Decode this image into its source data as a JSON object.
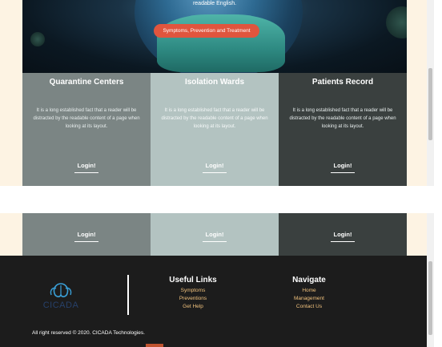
{
  "hero": {
    "text": "readable English.",
    "button_label": "Symptoms, Prevention and Treatment"
  },
  "cards": [
    {
      "title": "Quarantine Centers",
      "text": "It is a long established fact that a reader will be distracted by the readable content of a page when looking at its layout.",
      "login": "Login!"
    },
    {
      "title": "Isolation Wards",
      "text": "It is a long established fact that a reader will be distracted by the readable content of a page when looking at its layout.",
      "login": "Login!"
    },
    {
      "title": "Patients Record",
      "text": "It is a long established fact that a reader will be distracted by the readable content of a page when looking at its layout.",
      "login": "Login!"
    }
  ],
  "bottom_cards": [
    {
      "login": "Login!"
    },
    {
      "login": "Login!"
    },
    {
      "login": "Login!"
    }
  ],
  "footer": {
    "logo_text": "CICADA",
    "useful_links": {
      "title": "Useful Links",
      "items": [
        "Symptoms",
        "Preventions",
        "Get Help"
      ]
    },
    "navigate": {
      "title": "Navigate",
      "items": [
        "Home",
        "Management",
        "Contact Us"
      ]
    },
    "copyright": "All right reserved © 2020. CICADA Technologies."
  },
  "colors": {
    "accent_button": "#e0553e",
    "card_1": "#7b8584",
    "card_2": "#b3c3c1",
    "card_3": "#3a403f",
    "footer_bg": "#1c1c1c",
    "footer_link": "#f1c27d",
    "page_bg": "#fdf3e3"
  }
}
